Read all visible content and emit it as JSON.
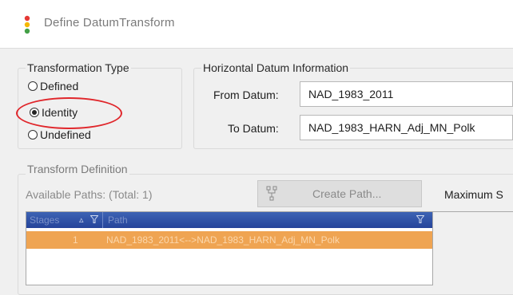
{
  "window": {
    "title": "Define DatumTransform",
    "icon": "traffic-light-icon"
  },
  "transformation_type": {
    "label": "Transformation Type",
    "options": [
      {
        "label": "Defined",
        "selected": false
      },
      {
        "label": "Identity",
        "selected": true
      },
      {
        "label": "Undefined",
        "selected": false
      }
    ]
  },
  "horizontal_datum": {
    "label": "Horizontal Datum Information",
    "from_label": "From Datum:",
    "from_value": "NAD_1983_2011",
    "to_label": "To Datum:",
    "to_value": "NAD_1983_HARN_Adj_MN_Polk"
  },
  "transform_definition": {
    "label": "Transform Definition",
    "available_paths": "Available Paths: (Total: 1)",
    "create_path_label": "Create Path...",
    "maximum_label": "Maximum S"
  },
  "grid": {
    "columns": {
      "stages": "Stages",
      "path": "Path"
    },
    "rows": [
      {
        "stages": "1",
        "path": "NAD_1983_2011<-->NAD_1983_HARN_Adj_MN_Polk"
      }
    ]
  },
  "colors": {
    "highlight_ellipse": "#e0262b",
    "grid_header": "#2f52a8",
    "selected_row": "#efa452"
  }
}
